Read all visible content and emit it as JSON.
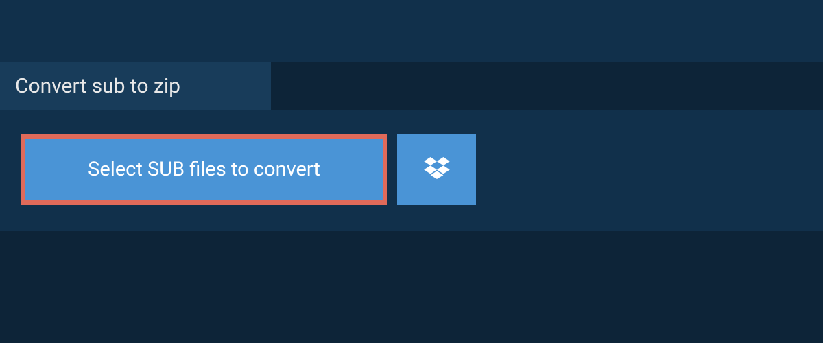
{
  "tab": {
    "title": "Convert sub to zip"
  },
  "buttons": {
    "select_label": "Select SUB files to convert"
  },
  "colors": {
    "page_bg": "#0d2438",
    "panel_bg": "#11304b",
    "tab_bg": "#183c5a",
    "button_bg": "#4a94d6",
    "button_border": "#e06a5a",
    "text_light": "#e8e8e8",
    "text_white": "#ffffff"
  }
}
